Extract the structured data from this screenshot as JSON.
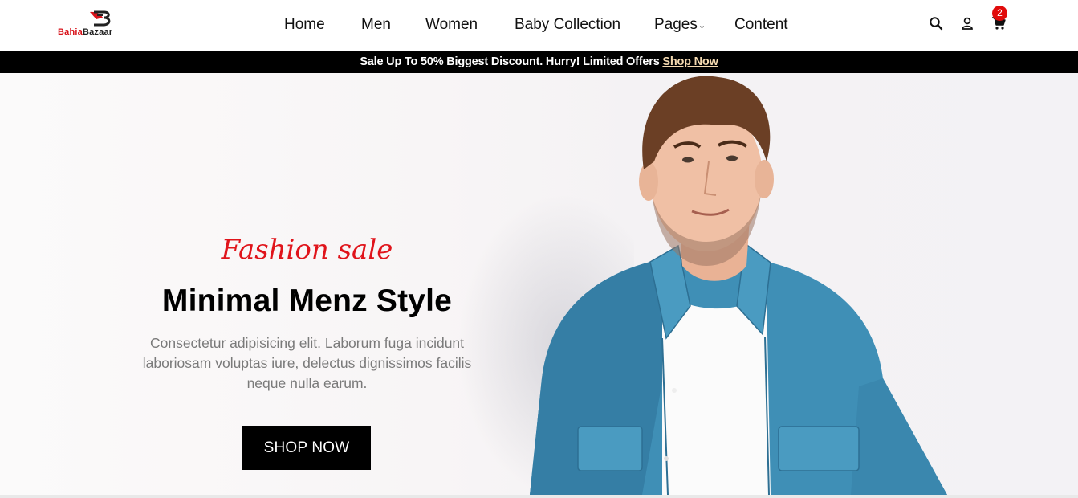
{
  "header": {
    "logo": {
      "part1": "Bahia",
      "part2": "Bazaar",
      "mark_icon": "bb-monogram-logo"
    },
    "nav": [
      {
        "label": "Home"
      },
      {
        "label": "Men"
      },
      {
        "label": "Women"
      },
      {
        "label": "Baby Collection"
      },
      {
        "label": "Pages",
        "has_dropdown": true,
        "chevron": "⌄"
      },
      {
        "label": "Content"
      }
    ],
    "icons": [
      "search-icon",
      "user-icon",
      "cart-icon"
    ],
    "cart_count": "2"
  },
  "promo": {
    "text": "Sale Up To 50% Biggest Discount. Hurry! Limited Offers ",
    "link": "Shop Now"
  },
  "hero": {
    "subtitle": "Fashion sale",
    "title": "Minimal Menz Style",
    "description": "Consectetur adipisicing elit. Laborum fuga incidunt laboriosam voluptas iure, delectus dignissimos facilis neque nulla earum.",
    "button": "SHOP NOW",
    "image": "man-in-denim-shirt-photo"
  },
  "colors": {
    "accent": "#e0141b",
    "badge": "#e10b0b",
    "promo_bg": "#000000",
    "promo_link": "#f4d9b0",
    "denim": "#3f8fb6"
  }
}
